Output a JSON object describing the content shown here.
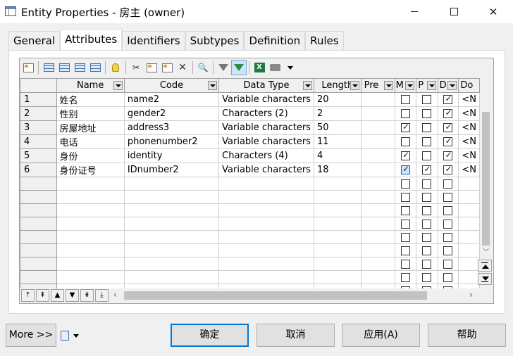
{
  "window": {
    "title": "Entity Properties - 房主 (owner)",
    "close_glyph": "✕"
  },
  "tabs": [
    {
      "label": "General",
      "active": false
    },
    {
      "label": "Attributes",
      "active": true
    },
    {
      "label": "Identifiers",
      "active": false
    },
    {
      "label": "Subtypes",
      "active": false
    },
    {
      "label": "Definition",
      "active": false
    },
    {
      "label": "Rules",
      "active": false
    }
  ],
  "toolbar": {
    "icons": [
      "properties-icon",
      "insert-row-icon",
      "add-row-icon",
      "add-attributes-icon",
      "reuse-attributes-icon",
      "new-lightbulb-icon",
      "cut-icon",
      "copy-icon",
      "paste-icon",
      "delete-icon",
      "find-icon",
      "filter-icon",
      "enable-filter-icon",
      "export-excel-icon",
      "print-icon",
      "dropdown-caret-icon"
    ],
    "delete_glyph": "✕",
    "find_glyph": "🔍"
  },
  "table": {
    "columns": [
      "Name",
      "Code",
      "Data Type",
      "Length",
      "Pre",
      "M",
      "P",
      "D",
      "Do"
    ],
    "rows": [
      {
        "num": "1",
        "name": "姓名",
        "code": "name2",
        "type": "Variable characters",
        "length": "20",
        "pre": "",
        "m": false,
        "p": false,
        "d": true,
        "do": "<N"
      },
      {
        "num": "2",
        "name": "性别",
        "code": "gender2",
        "type": "Characters (2)",
        "length": "2",
        "pre": "",
        "m": false,
        "p": false,
        "d": true,
        "do": "<N"
      },
      {
        "num": "3",
        "name": "房屋地址",
        "code": "address3",
        "type": "Variable characters",
        "length": "50",
        "pre": "",
        "m": true,
        "p": false,
        "d": true,
        "do": "<N"
      },
      {
        "num": "4",
        "name": "电话",
        "code": "phonenumber2",
        "type": "Variable characters",
        "length": "11",
        "pre": "",
        "m": false,
        "p": false,
        "d": true,
        "do": "<N"
      },
      {
        "num": "5",
        "name": "身份",
        "code": "identity",
        "type": "Characters (4)",
        "length": "4",
        "pre": "",
        "m": true,
        "p": false,
        "d": true,
        "do": "<N"
      },
      {
        "num": "6",
        "name": "身份证号",
        "code": "IDnumber2",
        "type": "Variable characters",
        "length": "18",
        "pre": "",
        "m": true,
        "p": true,
        "d": true,
        "do": "<N"
      }
    ],
    "empty_rows": 9
  },
  "buttons": {
    "more": "More >>",
    "ok": "确定",
    "cancel": "取消",
    "apply": "应用(A)",
    "help": "帮助"
  },
  "colors": {
    "accent": "#0078d7",
    "selected_checkbox": "#cde4fa"
  }
}
